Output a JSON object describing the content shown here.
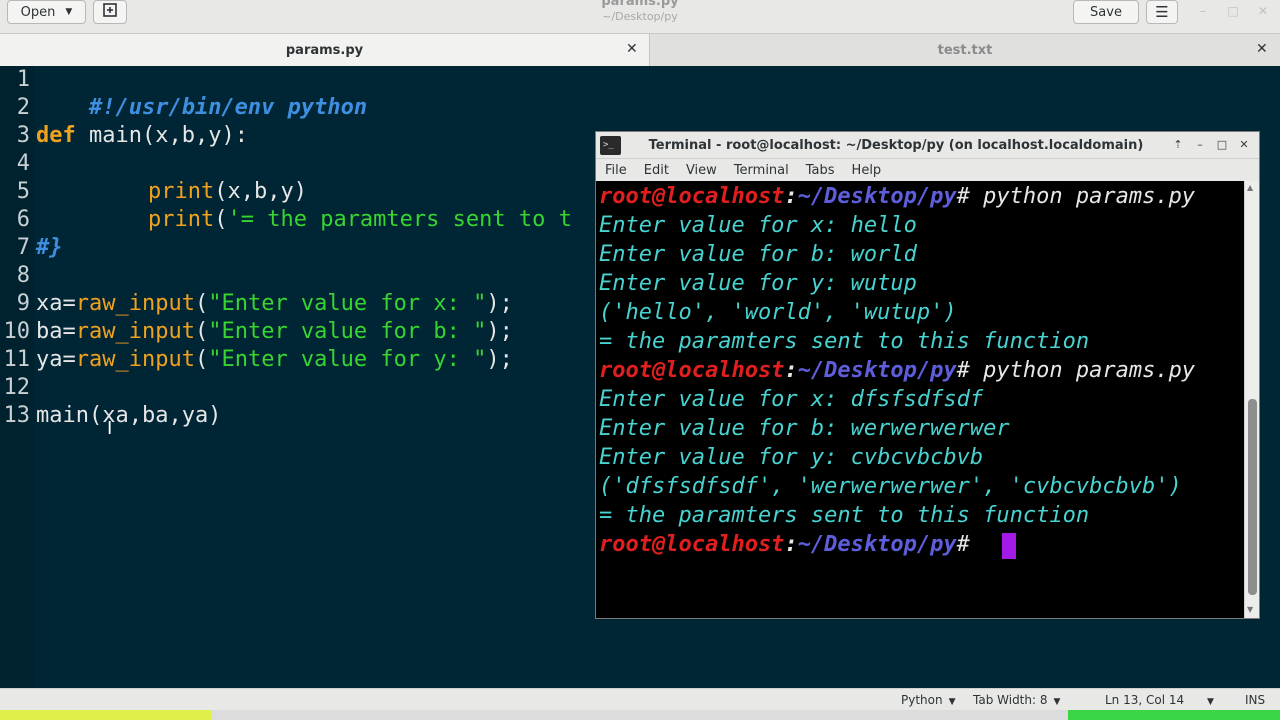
{
  "header": {
    "open_label": "Open",
    "save_label": "Save",
    "title": "params.py",
    "subtitle": "~/Desktop/py"
  },
  "tabs": [
    {
      "label": "params.py",
      "active": true
    },
    {
      "label": "test.txt",
      "active": false
    }
  ],
  "editor": {
    "line_numbers": [
      "1",
      "2",
      "3",
      "4",
      "5",
      "6",
      "7",
      "8",
      "9",
      "10",
      "11",
      "12",
      "13"
    ],
    "lines": {
      "l1": "#!/usr/bin/env python",
      "l3_kw": "def",
      "l3_rest": " main(x,b,y):",
      "l5_fn": "print",
      "l5_rest": "(x,b,y)",
      "l6_fn": "print",
      "l6_paren": "(",
      "l6_str": "'= the paramters sent to t",
      "l7": "#}",
      "l9_var": "xa=",
      "l9_fn": "raw_input",
      "l9_paren": "(",
      "l9_str": "\"Enter value for x: \"",
      "l9_end": ");",
      "l10_var": "ba=",
      "l10_fn": "raw_input",
      "l10_paren": "(",
      "l10_str": "\"Enter value for b: \"",
      "l10_end": ");",
      "l11_var": "ya=",
      "l11_fn": "raw_input",
      "l11_paren": "(",
      "l11_str": "\"Enter value for y: \"",
      "l11_end": ");",
      "l13": "main(xa,ba,ya)"
    }
  },
  "terminal": {
    "title": "Terminal - root@localhost: ~/Desktop/py (on localhost.localdomain)",
    "menu": [
      "File",
      "Edit",
      "View",
      "Terminal",
      "Tabs",
      "Help"
    ],
    "prompt_user": "root@localhost",
    "prompt_colon": ":",
    "prompt_path": "~/Desktop/py",
    "command": "# python params.py",
    "prompt_end": "#",
    "output": [
      "Enter value for x: hello",
      "Enter value for b: world",
      "Enter value for y: wutup",
      "('hello', 'world', 'wutup')",
      "= the paramters sent to this function",
      "Enter value for x: dfsfsdfsdf",
      "Enter value for b: werwerwerwer",
      "Enter value for y: cvbcvbcbvb",
      "('dfsfsdfsdf', 'werwerwerwer', 'cvbcvbcbvb')",
      "= the paramters sent to this function"
    ]
  },
  "statusbar": {
    "language": "Python",
    "tab_width": "Tab Width: 8",
    "position": "Ln 13, Col 14",
    "mode": "INS"
  }
}
